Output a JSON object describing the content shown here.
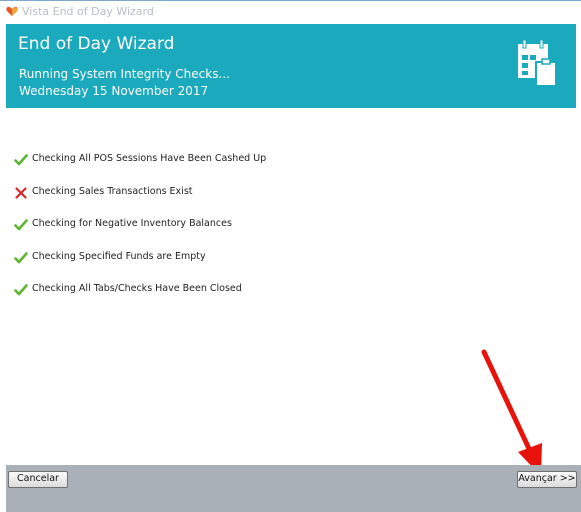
{
  "window": {
    "title": "Vista End of Day Wizard",
    "icon": "vista-heart-icon"
  },
  "header": {
    "title": "End of Day Wizard",
    "subtitle_line1": "Running System Integrity Checks...",
    "subtitle_line2": "Wednesday 15 November 2017",
    "icon": "calendar-clipboard-icon",
    "bg_color": "#1aa9bd"
  },
  "checks": [
    {
      "label": "Checking All POS Sessions Have Been Cashed Up",
      "status": "pass"
    },
    {
      "label": "Checking Sales Transactions Exist",
      "status": "fail"
    },
    {
      "label": "Checking for Negative Inventory Balances",
      "status": "pass"
    },
    {
      "label": "Checking Specified Funds are Empty",
      "status": "pass"
    },
    {
      "label": "Checking All Tabs/Checks Have Been Closed",
      "status": "pass"
    }
  ],
  "status_colors": {
    "pass": "#5cb531",
    "fail": "#d9262b"
  },
  "annotation": {
    "color": "#e8120c",
    "icon": "red-arrow-icon"
  },
  "footer": {
    "cancel_label": "Cancelar",
    "next_label": "Avançar >>"
  }
}
